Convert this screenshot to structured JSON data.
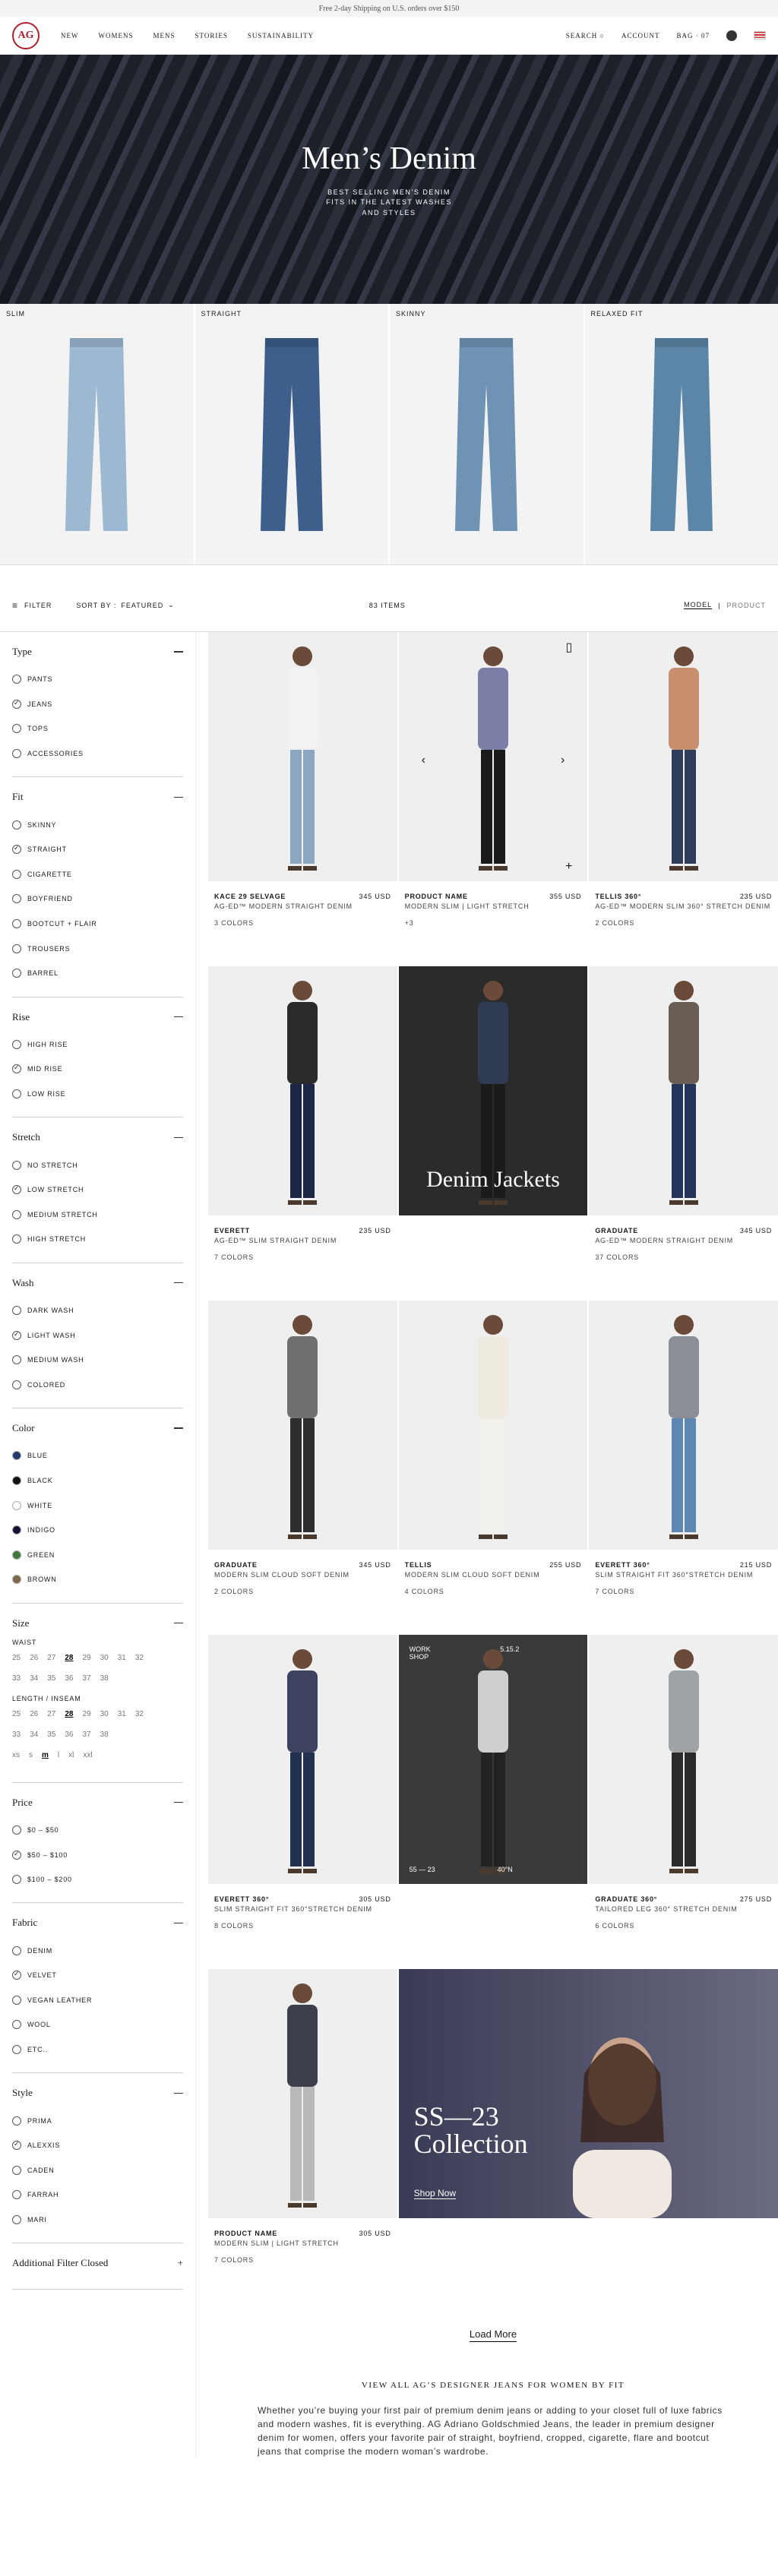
{
  "topbar": "Free 2-day Shipping on U.S. orders over $150",
  "nav": {
    "logo": "AG",
    "links": [
      "NEW",
      "WOMENS",
      "MENS",
      "STORIES",
      "SUSTAINABILITY"
    ],
    "search": "SEARCH",
    "account": "ACCOUNT",
    "bag": "BAG · 07"
  },
  "hero": {
    "title": "Men’s Denim",
    "subtitle": "BEST SELLING MEN’S DENIM FITS IN THE LATEST WASHES AND STYLES"
  },
  "categories": [
    {
      "label": "SLIM",
      "color": "#9db8d1"
    },
    {
      "label": "STRAIGHT",
      "color": "#3e5e8c"
    },
    {
      "label": "SKINNY",
      "color": "#6f93b5"
    },
    {
      "label": "RELAXED FIT",
      "color": "#5b86a8"
    }
  ],
  "toolbar": {
    "filter": "FILTER",
    "sort_prefix": "SORT BY :",
    "sort_value": "FEATURED",
    "count": "83 ITEMS",
    "model": "MODEL",
    "product": "PRODUCT"
  },
  "filters": {
    "type": {
      "title": "Type",
      "options": [
        "PANTS",
        "JEANS",
        "TOPS",
        "ACCESSORIES"
      ],
      "checked": [
        1
      ]
    },
    "fit": {
      "title": "Fit",
      "options": [
        "SKINNY",
        "STRAIGHT",
        "CIGARETTE",
        "BOYFRIEND",
        "BOOTCUT + FLAIR",
        "TROUSERS",
        "BARREL"
      ],
      "checked": [
        1
      ]
    },
    "rise": {
      "title": "Rise",
      "options": [
        "HIGH RISE",
        "MID RISE",
        "LOW RISE"
      ],
      "checked": [
        1
      ]
    },
    "stretch": {
      "title": "Stretch",
      "options": [
        "NO STRETCH",
        "LOW STRETCH",
        "MEDIUM STRETCH",
        "HIGH STRETCH"
      ],
      "checked": [
        1
      ]
    },
    "wash": {
      "title": "Wash",
      "options": [
        "DARK WASH",
        "LIGHT WASH",
        "MEDIUM WASH",
        "COLORED"
      ],
      "checked": [
        1
      ]
    },
    "color": {
      "title": "Color",
      "options": [
        "BLUE",
        "BLACK",
        "WHITE",
        "INDIGO",
        "GREEN",
        "BROWN"
      ],
      "swatches": [
        "#1f3a6b",
        "#111111",
        "#ffffff",
        "#0f1230",
        "#3e7a3a",
        "#7a6a4a"
      ]
    },
    "size": {
      "title": "Size",
      "waist": "WAIST",
      "inseam": "LENGTH / INSEAM",
      "row1": [
        "25",
        "26",
        "27",
        "28",
        "29",
        "30",
        "31",
        "32"
      ],
      "row2": [
        "33",
        "34",
        "35",
        "36",
        "37",
        "38"
      ],
      "letters": [
        "xs",
        "s",
        "m",
        "l",
        "xl",
        "xxl"
      ]
    },
    "price": {
      "title": "Price",
      "options": [
        "$0 – $50",
        "$50 – $100",
        "$100 – $200"
      ],
      "checked": [
        1
      ]
    },
    "fabric": {
      "title": "Fabric",
      "options": [
        "DENIM",
        "VELVET",
        "VEGAN LEATHER",
        "WOOL",
        "ETC.."
      ],
      "checked": [
        1
      ]
    },
    "style": {
      "title": "Style",
      "options": [
        "PRIMA",
        "ALEXXIS",
        "CADEN",
        "FARRAH",
        "MARI"
      ],
      "checked": [
        1
      ]
    },
    "additional": "Additional Filter Closed"
  },
  "products": [
    {
      "name": "KACE 29 SELVAGE",
      "desc": "AG-ED™ MODERN STRAIGHT DENIM",
      "price": "345 USD",
      "colors": "3 COLORS",
      "top": "#f2f2f2",
      "bottom": "#8aa6c1"
    },
    {
      "name": "PRODUCT NAME",
      "desc": "MODERN SLIM | LIGHT STRETCH",
      "price": "355 USD",
      "colors": "+3",
      "top": "#7b7fa8",
      "bottom": "#1a1a1a"
    },
    {
      "name": "TELLIS 360°",
      "desc": "AG-ED™ MODERN SLIM 360° STRETCH DENIM",
      "price": "235 USD",
      "colors": "2 COLORS",
      "top": "#c78f6d",
      "bottom": "#2d3d5a"
    },
    {
      "name": "EVERETT",
      "desc": "AG-ED™ SLIM STRAIGHT DENIM",
      "price": "235 USD",
      "colors": "7 COLORS",
      "top": "#2a2a2a",
      "bottom": "#1b2744"
    },
    {
      "feature": "Denim Jackets"
    },
    {
      "name": "GRADUATE",
      "desc": "AG-ED™ MODERN STRAIGHT DENIM",
      "price": "345 USD",
      "colors": "37 COLORS",
      "top": "#6b5e56",
      "bottom": "#24355a"
    },
    {
      "name": "GRADUATE",
      "desc": "MODERN SLIM CLOUD SOFT DENIM",
      "price": "345 USD",
      "colors": "2 COLORS",
      "top": "#707070",
      "bottom": "#2e2e2e"
    },
    {
      "name": "TELLIS",
      "desc": "MODERN SLIM CLOUD SOFT DENIM",
      "price": "255 USD",
      "colors": "4 COLORS",
      "top": "#eeeae0",
      "bottom": "#f2f0ea"
    },
    {
      "name": "EVERETT 360°",
      "desc": "SLIM STRAIGHT FIT 360°STRETCH DENIM",
      "price": "215 USD",
      "colors": "7 COLORS",
      "top": "#8a8f95",
      "bottom": "#5d86b3"
    },
    {
      "name": "EVERETT 360°",
      "desc": "SLIM STRAIGHT FIT 360°STRETCH DENIM",
      "price": "305 USD",
      "colors": "8 COLORS",
      "top": "#3c4260",
      "bottom": "#22314f"
    },
    {
      "editorial": {
        "tag": "WORK SHOP",
        "date": "5.15.2",
        "left": "55 — 23",
        "right": "40°N"
      }
    },
    {
      "name": "GRADUATE 360°",
      "desc": "TAILORED LEG 360° STRETCH DENIM",
      "price": "275 USD",
      "colors": "6 COLORS",
      "top": "#9ea3a8",
      "bottom": "#2a2a2a"
    },
    {
      "name": "PRODUCT NAME",
      "desc": "MODERN SLIM | LIGHT STRETCH",
      "price": "305 USD",
      "colors": "7 COLORS",
      "top": "#3c3f4c",
      "bottom": "#b9b9b9"
    }
  ],
  "campaign": {
    "title": "SS—23 Collection",
    "cta": "Shop Now"
  },
  "load_more": "Load More",
  "view_all": "VIEW ALL AG’S DESIGNER JEANS FOR WOMEN BY FIT",
  "copy": "Whether you’re buying your first pair of premium denim jeans or adding to your closet full of luxe fabrics and modern washes, fit is everything. AG Adriano Goldschmied Jeans, the leader in premium designer denim for women, offers your favorite pair of straight, boyfriend, cropped, cigarette, flare and bootcut jeans that comprise the modern woman’s wardrobe."
}
